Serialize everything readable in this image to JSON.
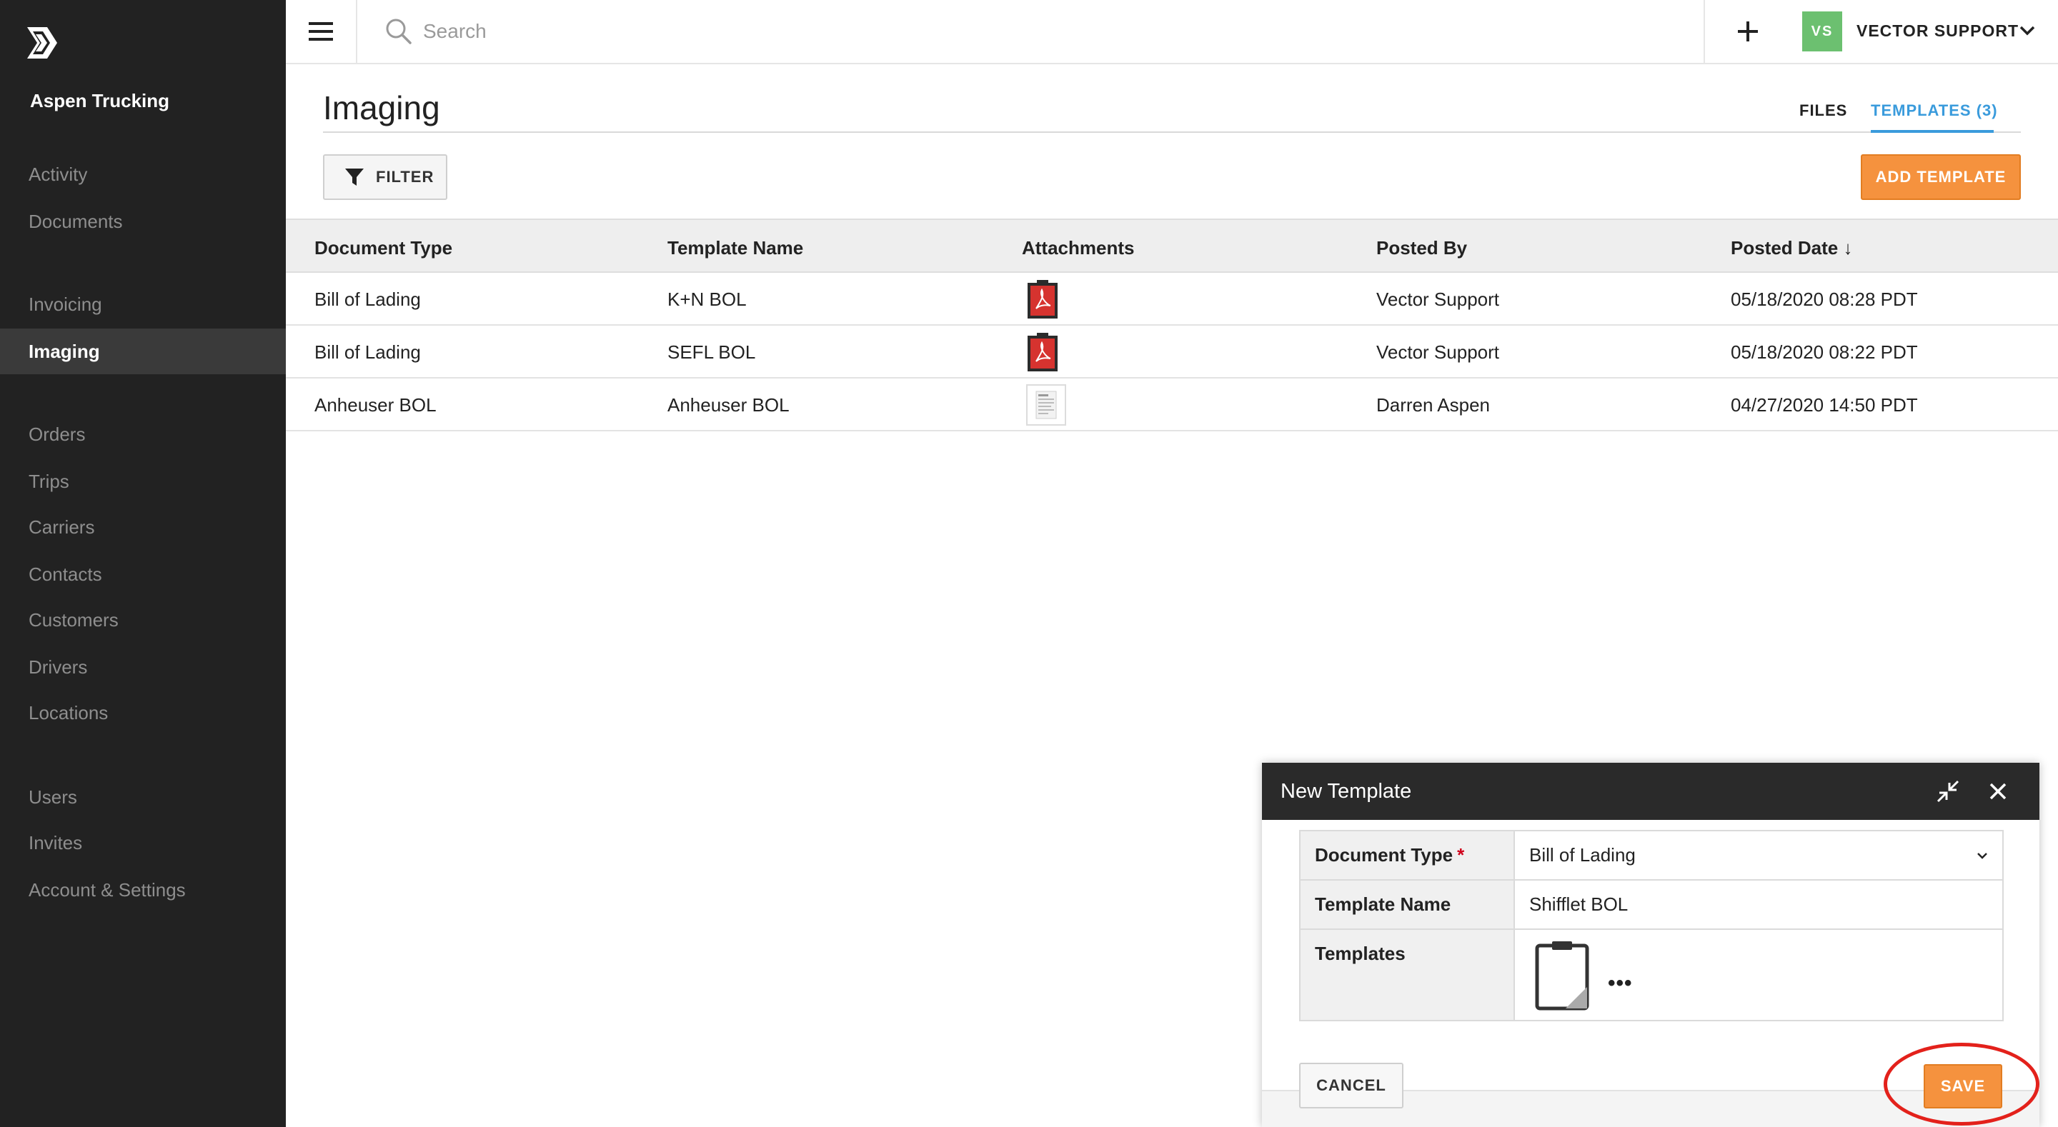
{
  "sidebar": {
    "company": "Aspen Trucking",
    "items": [
      {
        "label": "Activity",
        "active": false
      },
      {
        "label": "Documents",
        "active": false
      },
      {
        "label": "Invoicing",
        "active": false
      },
      {
        "label": "Imaging",
        "active": true
      },
      {
        "label": "Orders",
        "active": false
      },
      {
        "label": "Trips",
        "active": false
      },
      {
        "label": "Carriers",
        "active": false
      },
      {
        "label": "Contacts",
        "active": false
      },
      {
        "label": "Customers",
        "active": false
      },
      {
        "label": "Drivers",
        "active": false
      },
      {
        "label": "Locations",
        "active": false
      },
      {
        "label": "Users",
        "active": false
      },
      {
        "label": "Invites",
        "active": false
      },
      {
        "label": "Account & Settings",
        "active": false
      }
    ]
  },
  "topbar": {
    "search_placeholder": "Search",
    "avatar_initials": "VS",
    "user_name": "VECTOR SUPPORT"
  },
  "page": {
    "title": "Imaging",
    "tabs": [
      {
        "label": "FILES",
        "active": false
      },
      {
        "label": "TEMPLATES (3)",
        "active": true
      }
    ],
    "filter_label": "FILTER",
    "add_template_label": "ADD TEMPLATE"
  },
  "table": {
    "columns": [
      "Document Type",
      "Template Name",
      "Attachments",
      "Posted By",
      "Posted Date ↓"
    ],
    "rows": [
      {
        "document_type": "Bill of Lading",
        "template_name": "K+N BOL",
        "attachment": "pdf-icon",
        "posted_by": "Vector Support",
        "posted_date": "05/18/2020 08:28 PDT"
      },
      {
        "document_type": "Bill of Lading",
        "template_name": "SEFL BOL",
        "attachment": "pdf-icon",
        "posted_by": "Vector Support",
        "posted_date": "05/18/2020 08:22 PDT"
      },
      {
        "document_type": "Anheuser BOL",
        "template_name": "Anheuser BOL",
        "attachment": "document-thumbnail-icon",
        "posted_by": "Darren Aspen",
        "posted_date": "04/27/2020 14:50 PDT"
      }
    ]
  },
  "modal": {
    "title": "New Template",
    "fields": {
      "document_type_label": "Document Type",
      "document_type_required": "*",
      "document_type_value": "Bill of Lading",
      "template_name_label": "Template Name",
      "template_name_value": "Shifflet BOL",
      "templates_label": "Templates",
      "more_label": "•••"
    },
    "cancel_label": "CANCEL",
    "save_label": "SAVE"
  },
  "colors": {
    "sidebar_bg": "#222222",
    "accent_orange": "#f5923e",
    "tab_active": "#3a9bdc",
    "avatar_bg": "#6cc070",
    "highlight_ring": "#e3211b"
  }
}
